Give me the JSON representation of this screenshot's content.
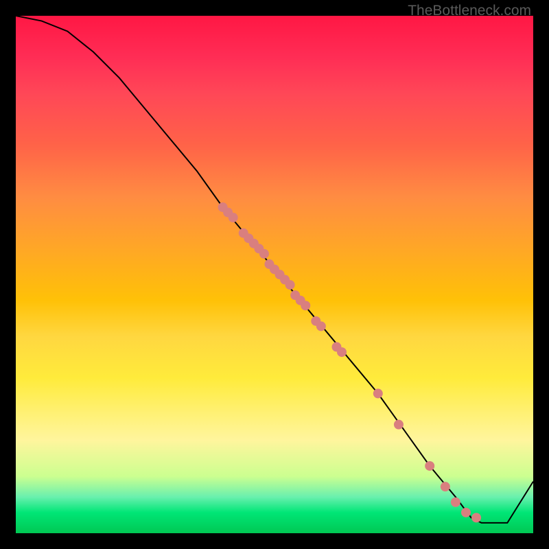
{
  "watermark": "TheBottleneck.com",
  "chart_data": {
    "type": "line",
    "title": "",
    "xlabel": "",
    "ylabel": "",
    "xlim": [
      0,
      100
    ],
    "ylim": [
      0,
      100
    ],
    "curve": {
      "x": [
        0,
        5,
        10,
        15,
        20,
        25,
        30,
        35,
        40,
        45,
        50,
        55,
        60,
        65,
        70,
        75,
        80,
        85,
        88,
        90,
        95,
        100
      ],
      "y": [
        100,
        99,
        97,
        93,
        88,
        82,
        76,
        70,
        63,
        57,
        51,
        45,
        39,
        33,
        27,
        20,
        13,
        7,
        3,
        2,
        2,
        10
      ]
    },
    "markers": {
      "x": [
        40,
        41,
        42,
        44,
        45,
        46,
        47,
        48,
        49,
        50,
        51,
        52,
        53,
        54,
        55,
        56,
        58,
        59,
        62,
        63,
        70,
        74,
        80,
        83,
        85,
        87,
        89
      ],
      "y": [
        63,
        62,
        61,
        58,
        57,
        56,
        55,
        54,
        52,
        51,
        50,
        49,
        48,
        46,
        45,
        44,
        41,
        40,
        36,
        35,
        27,
        21,
        13,
        9,
        6,
        4,
        3
      ]
    },
    "marker_color": "#d97f7f",
    "line_color": "#000000"
  }
}
